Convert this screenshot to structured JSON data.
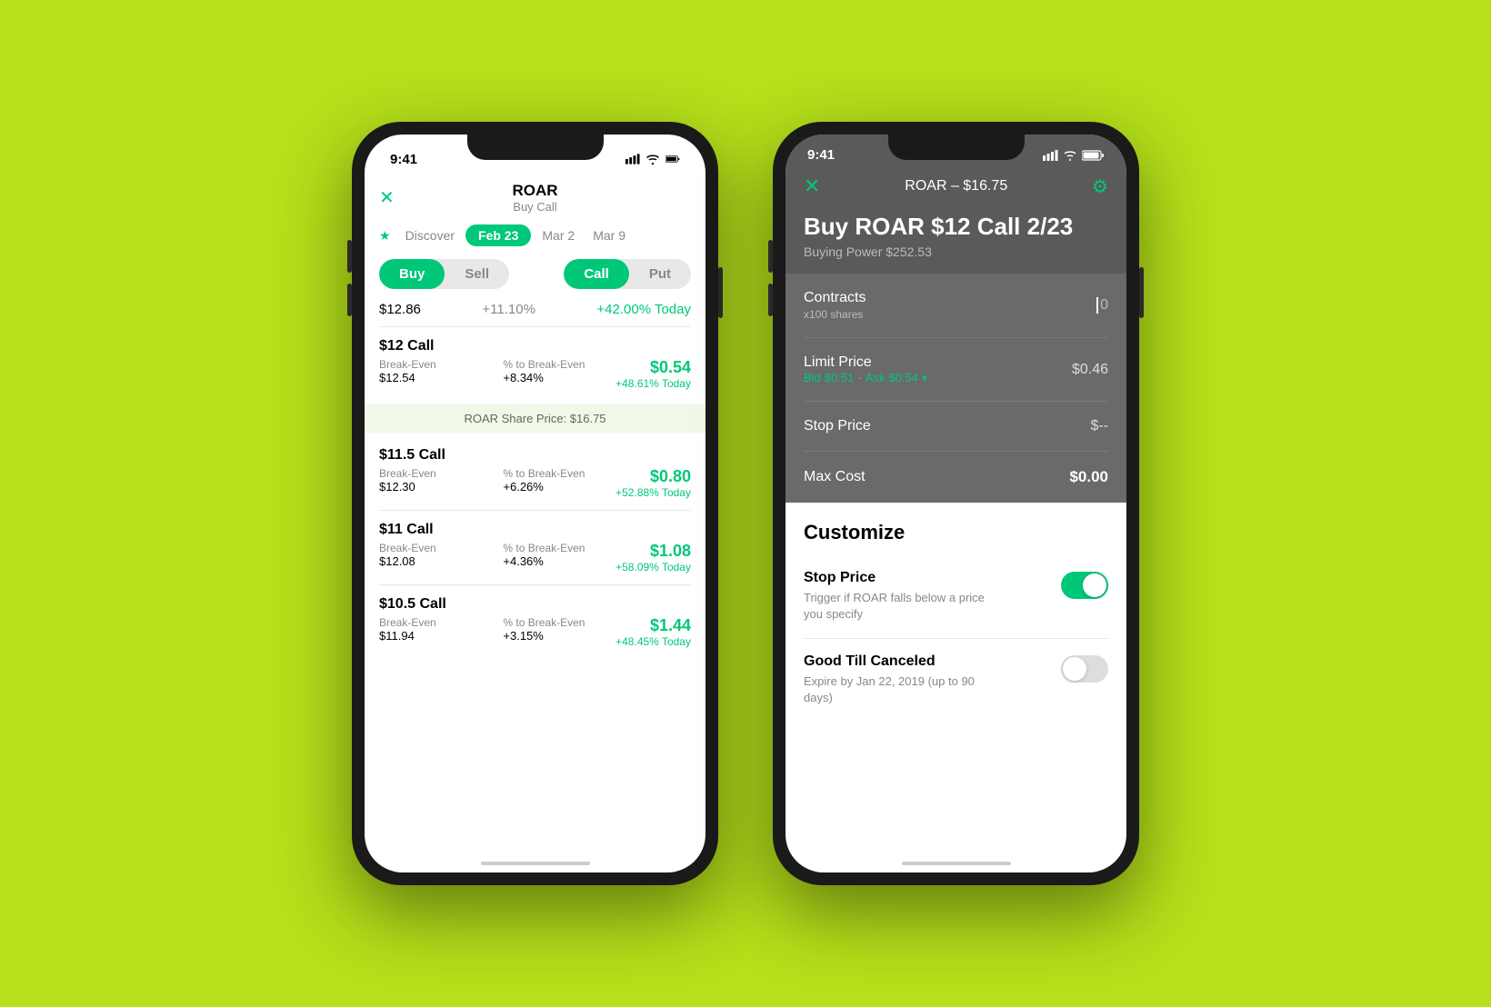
{
  "bg_color": "#b5e01a",
  "phone1": {
    "status": {
      "time": "9:41",
      "signal_bars": 3,
      "wifi": true,
      "battery": true
    },
    "header": {
      "close_label": "✕",
      "ticker": "ROAR",
      "subtitle": "Buy Call"
    },
    "tabs": [
      {
        "label": "Discover",
        "active": false,
        "has_star": true
      },
      {
        "label": "Feb 23",
        "active": true
      },
      {
        "label": "Mar 2",
        "active": false
      },
      {
        "label": "Mar 9",
        "active": false
      }
    ],
    "actions": {
      "buy_label": "Buy",
      "sell_label": "Sell",
      "call_label": "Call",
      "put_label": "Put",
      "active_action": "Buy",
      "active_type": "Call"
    },
    "price_row": {
      "price": "$12.86",
      "pct": "+11.10%",
      "today": "+42.00% Today"
    },
    "options": [
      {
        "name": "$12 Call",
        "breakeven_label": "Break-Even",
        "breakeven_val": "$12.54",
        "pct_label": "% to Break-Even",
        "pct_val": "+8.34%",
        "price": "$0.54",
        "change": "+48.61% Today"
      }
    ],
    "share_price_banner": "ROAR Share Price: $16.75",
    "options2": [
      {
        "name": "$11.5 Call",
        "breakeven_label": "Break-Even",
        "breakeven_val": "$12.30",
        "pct_label": "% to Break-Even",
        "pct_val": "+6.26%",
        "price": "$0.80",
        "change": "+52.88% Today"
      },
      {
        "name": "$11 Call",
        "breakeven_label": "Break-Even",
        "breakeven_val": "$12.08",
        "pct_label": "% to Break-Even",
        "pct_val": "+4.36%",
        "price": "$1.08",
        "change": "+58.09% Today"
      },
      {
        "name": "$10.5 Call",
        "breakeven_label": "Break-Even",
        "breakeven_val": "$11.94",
        "pct_label": "% to Break-Even",
        "pct_val": "+3.15%",
        "price": "$1.44",
        "change": "+48.45% Today"
      }
    ]
  },
  "phone2": {
    "status": {
      "time": "9:41"
    },
    "topbar": {
      "close_label": "✕",
      "title": "ROAR – $16.75",
      "gear_label": "⚙"
    },
    "order": {
      "title": "Buy ROAR $12 Call 2/23",
      "buying_power": "Buying Power $252.53"
    },
    "form_rows": [
      {
        "label": "Contracts",
        "sub": "x100 shares",
        "value": "0",
        "value_type": "input"
      },
      {
        "label": "Limit Price",
        "bid_ask": "Bid $0.51 · Ask $0.54",
        "value": "$0.46",
        "value_type": "price"
      },
      {
        "label": "Stop Price",
        "sub": "",
        "value": "$--",
        "value_type": "plain"
      },
      {
        "label": "Max Cost",
        "sub": "",
        "value": "$0.00",
        "value_type": "bold"
      }
    ],
    "customize": {
      "section_title": "Customize",
      "items": [
        {
          "label": "Stop Price",
          "desc": "Trigger if ROAR falls below a price you specify",
          "enabled": true
        },
        {
          "label": "Good Till Canceled",
          "desc": "Expire by Jan 22, 2019 (up to 90 days)",
          "enabled": false
        }
      ]
    },
    "bid_label": "Bid",
    "bid_val": "$0.51",
    "ask_label": "Ask",
    "ask_val": "$0.54"
  }
}
